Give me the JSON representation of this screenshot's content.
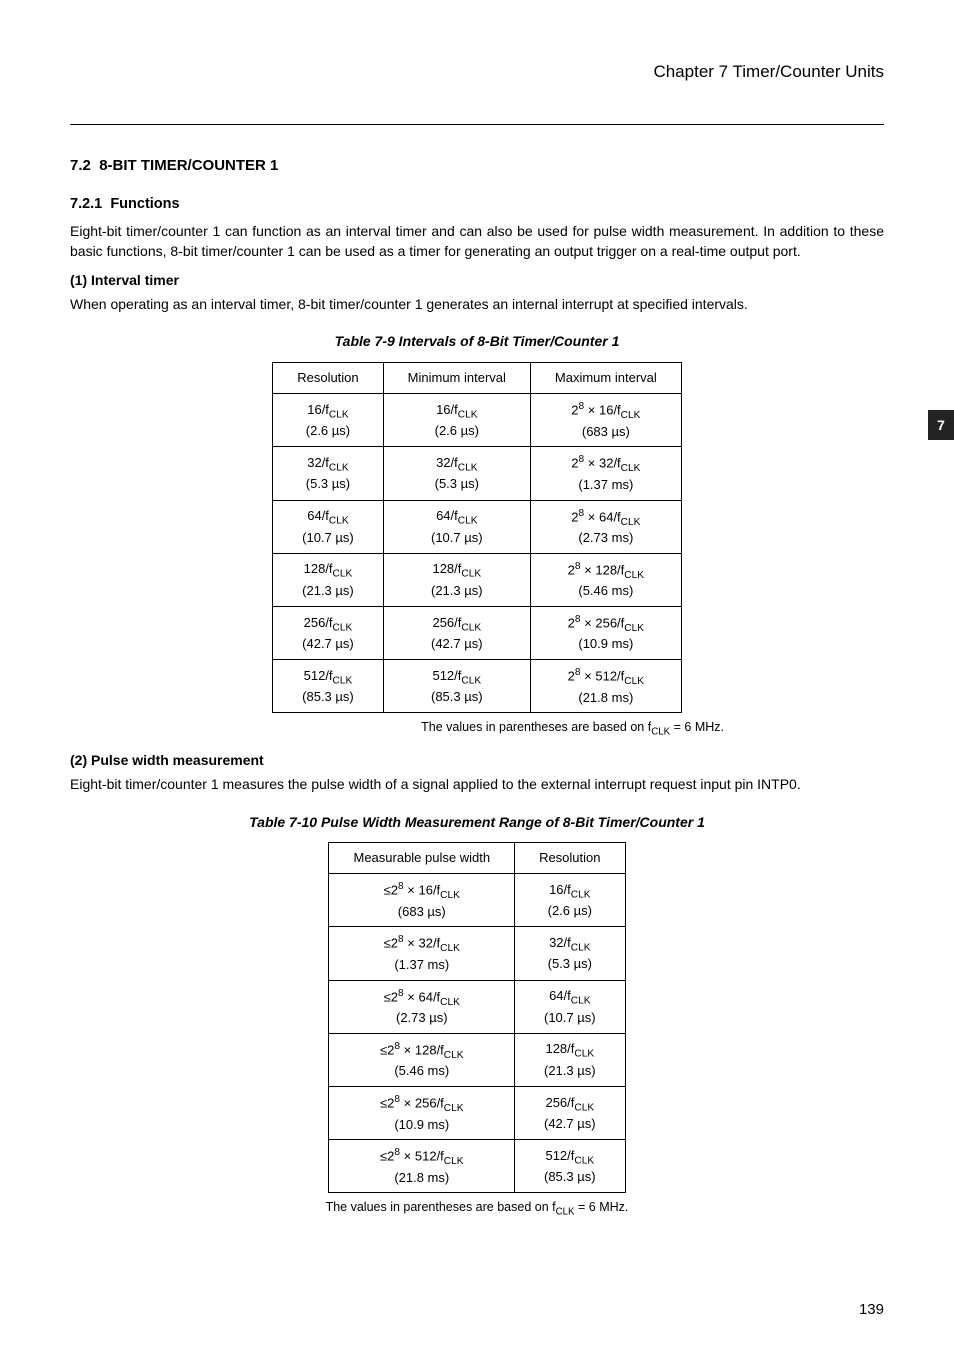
{
  "header": {
    "chapter": "Chapter 7   Timer/Counter Units"
  },
  "tab": "7",
  "section": {
    "num": "7.2",
    "title": "8-BIT TIMER/COUNTER 1"
  },
  "subsection": {
    "num": "7.2.1",
    "title": "Functions"
  },
  "intro": "Eight-bit timer/counter 1 can function as an interval timer and can also be used for pulse width measurement.  In addition to these basic functions, 8-bit timer/counter 1 can be used as a timer for generating an output trigger on a real-time output port.",
  "item1": {
    "head": "(1)   Interval timer",
    "body": "When operating as an interval timer, 8-bit timer/counter 1 generates an internal interrupt at specified intervals."
  },
  "table79": {
    "caption": "Table 7-9  Intervals of 8-Bit Timer/Counter 1",
    "cols": [
      "Resolution",
      "Minimum interval",
      "Maximum interval"
    ],
    "rows": [
      {
        "res_f": "16/f",
        "res_t": "(2.6 µs)",
        "min_f": "16/f",
        "min_t": "(2.6 µs)",
        "max_e": "2",
        "max_p": "8",
        "max_n": "16",
        "max_t": "(683 µs)"
      },
      {
        "res_f": "32/f",
        "res_t": "(5.3 µs)",
        "min_f": "32/f",
        "min_t": "(5.3 µs)",
        "max_e": "2",
        "max_p": "8",
        "max_n": "32",
        "max_t": "(1.37 ms)"
      },
      {
        "res_f": "64/f",
        "res_t": "(10.7 µs)",
        "min_f": "64/f",
        "min_t": "(10.7 µs)",
        "max_e": "2",
        "max_p": "8",
        "max_n": "64",
        "max_t": "(2.73 ms)"
      },
      {
        "res_f": "128/f",
        "res_t": "(21.3 µs)",
        "min_f": "128/f",
        "min_t": "(21.3 µs)",
        "max_e": "2",
        "max_p": "8",
        "max_n": "128",
        "max_t": "(5.46 ms)"
      },
      {
        "res_f": "256/f",
        "res_t": "(42.7 µs)",
        "min_f": "256/f",
        "min_t": "(42.7 µs)",
        "max_e": "2",
        "max_p": "8",
        "max_n": "256",
        "max_t": "(10.9 ms)"
      },
      {
        "res_f": "512/f",
        "res_t": "(85.3 µs)",
        "min_f": "512/f",
        "min_t": "(85.3 µs)",
        "max_e": "2",
        "max_p": "8",
        "max_n": "512",
        "max_t": "(21.8 ms)"
      }
    ],
    "note_pre": "The values in parentheses are based on f",
    "note_post": " = 6 MHz."
  },
  "item2": {
    "head": "(2)   Pulse width measurement",
    "body": "Eight-bit timer/counter 1 measures the pulse width of a signal applied to the external interrupt request input pin INTP0."
  },
  "table710": {
    "caption": "Table 7-10  Pulse Width Measurement Range of 8-Bit Timer/Counter 1",
    "cols": [
      "Measurable pulse width",
      "Resolution"
    ],
    "rows": [
      {
        "mp_e": "2",
        "mp_p": "8",
        "mp_n": "16",
        "mp_t": "(683 µs)",
        "res_f": "16/f",
        "res_t": "(2.6 µs)"
      },
      {
        "mp_e": "2",
        "mp_p": "8",
        "mp_n": "32",
        "mp_t": "(1.37 ms)",
        "res_f": "32/f",
        "res_t": "(5.3 µs)"
      },
      {
        "mp_e": "2",
        "mp_p": "8",
        "mp_n": "64",
        "mp_t": "(2.73 µs)",
        "res_f": "64/f",
        "res_t": "(10.7 µs)"
      },
      {
        "mp_e": "2",
        "mp_p": "8",
        "mp_n": "128",
        "mp_t": "(5.46 ms)",
        "res_f": "128/f",
        "res_t": "(21.3 µs)"
      },
      {
        "mp_e": "2",
        "mp_p": "8",
        "mp_n": "256",
        "mp_t": "(10.9 ms)",
        "res_f": "256/f",
        "res_t": "(42.7 µs)"
      },
      {
        "mp_e": "2",
        "mp_p": "8",
        "mp_n": "512",
        "mp_t": "(21.8 ms)",
        "res_f": "512/f",
        "res_t": "(85.3 µs)"
      }
    ],
    "note_pre": "The values in parentheses are based on f",
    "note_post": " = 6 MHz."
  },
  "clk_sub": "CLK",
  "footer": {
    "page": "139"
  }
}
